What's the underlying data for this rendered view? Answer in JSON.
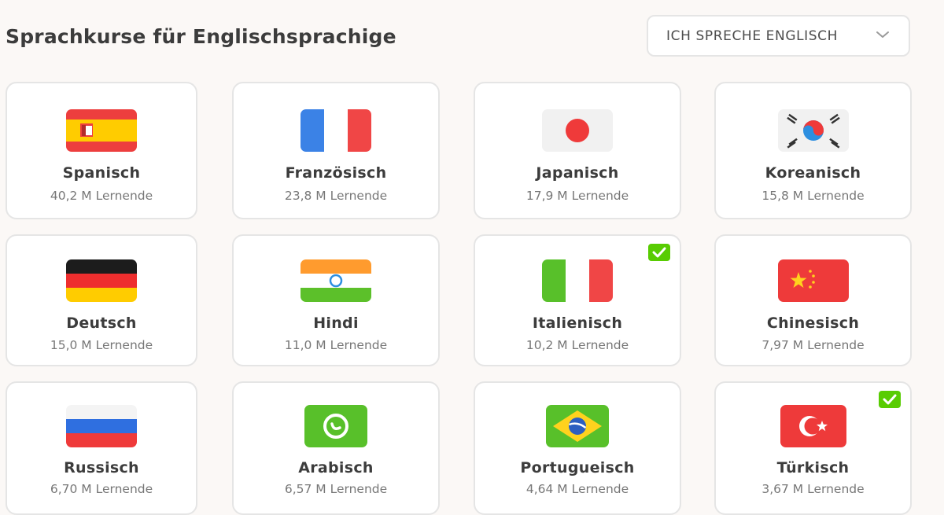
{
  "header": {
    "title": "Sprachkurse für Englischsprachige",
    "language_select": {
      "selected": "ICH SPRECHE ENGLISCH",
      "icon": "chevron-down-icon"
    }
  },
  "courses": [
    {
      "name": "Spanisch",
      "learners": "40,2 M Lernende",
      "flag_icon": "spain-flag-icon",
      "selected": false
    },
    {
      "name": "Französisch",
      "learners": "23,8 M Lernende",
      "flag_icon": "france-flag-icon",
      "selected": false
    },
    {
      "name": "Japanisch",
      "learners": "17,9 M Lernende",
      "flag_icon": "japan-flag-icon",
      "selected": false
    },
    {
      "name": "Koreanisch",
      "learners": "15,8 M Lernende",
      "flag_icon": "korea-flag-icon",
      "selected": false
    },
    {
      "name": "Deutsch",
      "learners": "15,0 M Lernende",
      "flag_icon": "germany-flag-icon",
      "selected": false
    },
    {
      "name": "Hindi",
      "learners": "11,0 M Lernende",
      "flag_icon": "india-flag-icon",
      "selected": false
    },
    {
      "name": "Italienisch",
      "learners": "10,2 M Lernende",
      "flag_icon": "italy-flag-icon",
      "selected": true
    },
    {
      "name": "Chinesisch",
      "learners": "7,97 M Lernende",
      "flag_icon": "china-flag-icon",
      "selected": false
    },
    {
      "name": "Russisch",
      "learners": "6,70 M Lernende",
      "flag_icon": "russia-flag-icon",
      "selected": false
    },
    {
      "name": "Arabisch",
      "learners": "6,57 M Lernende",
      "flag_icon": "arabic-icon",
      "selected": false
    },
    {
      "name": "Portugueisch",
      "learners": "4,64 M Lernende",
      "flag_icon": "brazil-flag-icon",
      "selected": false
    },
    {
      "name": "Türkisch",
      "learners": "3,67 M Lernende",
      "flag_icon": "turkey-flag-icon",
      "selected": true
    }
  ],
  "colors": {
    "background": "#fbf8f6",
    "card_border": "#e5e5e5",
    "check_green": "#58cc02",
    "title_text": "#3c3c3c",
    "secondary_text": "#777777"
  }
}
